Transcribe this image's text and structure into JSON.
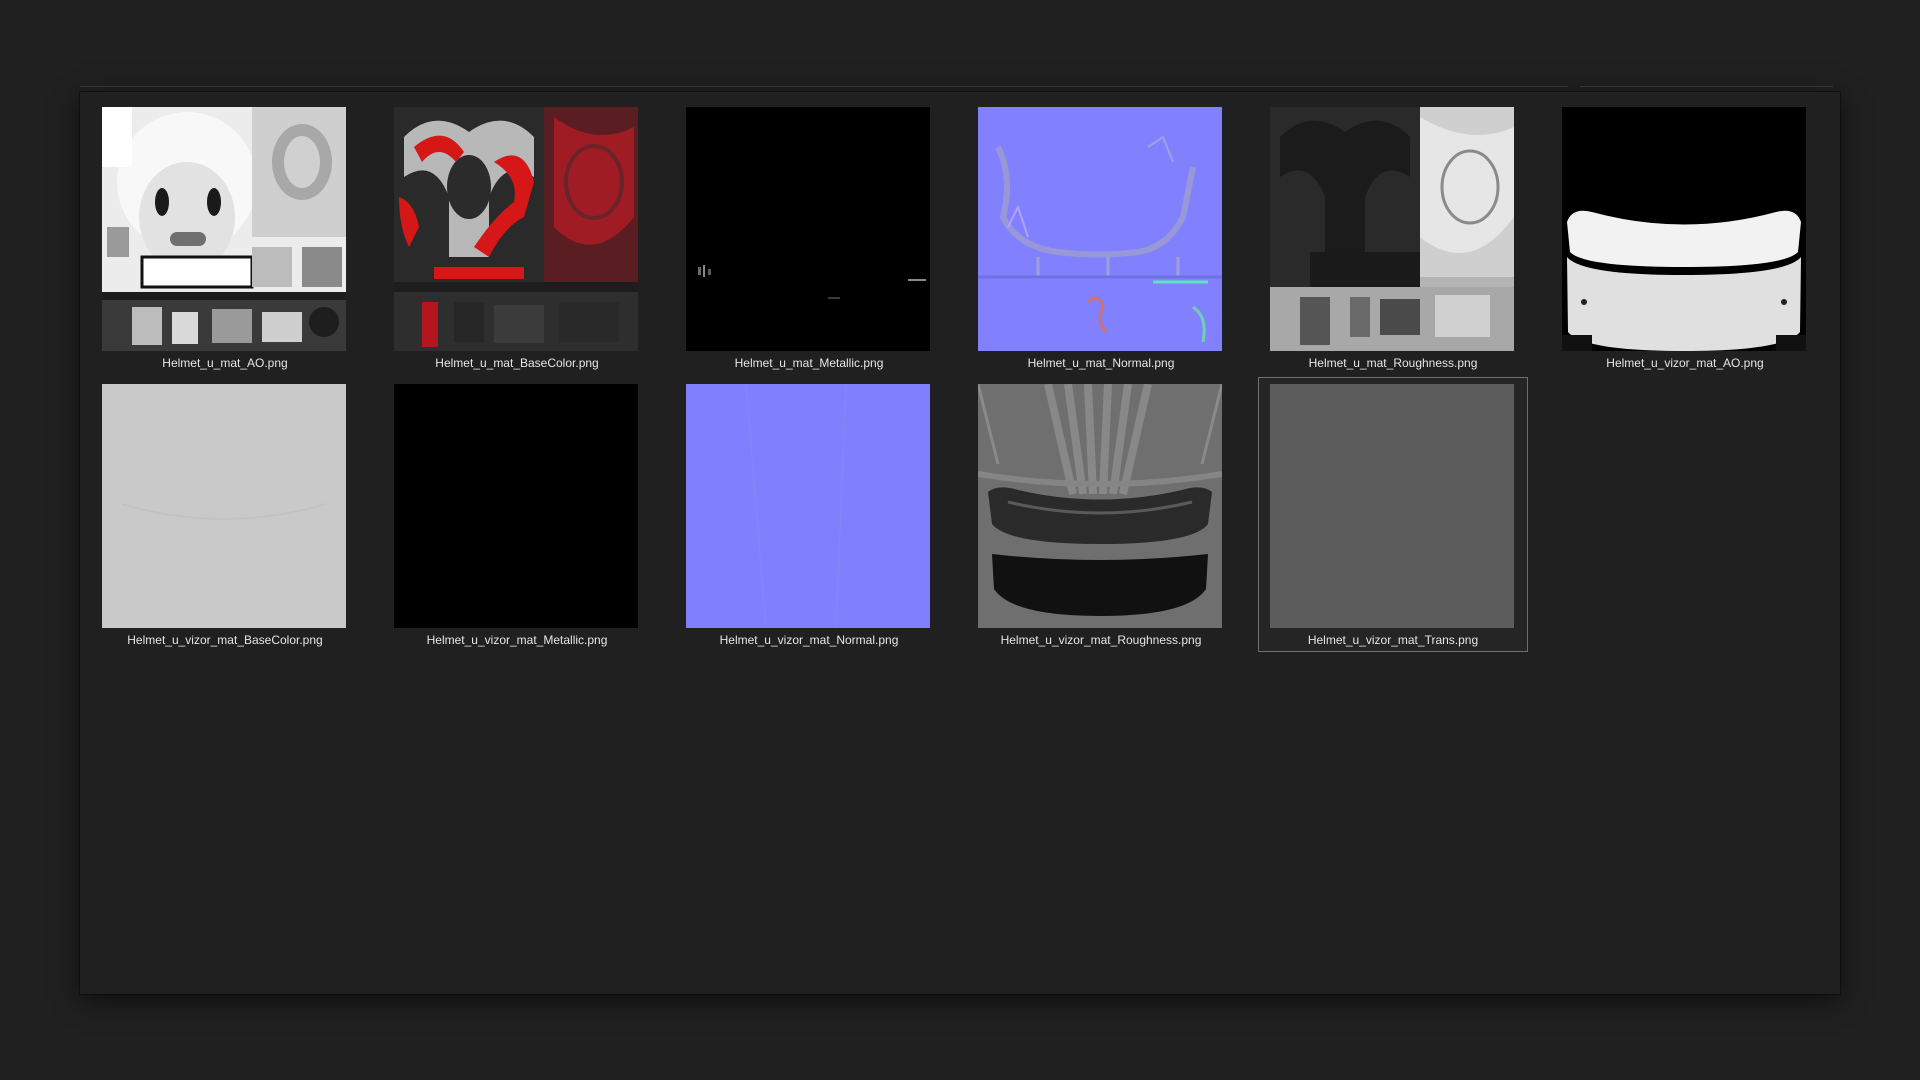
{
  "files": [
    {
      "name": "Helmet_u_mat_AO.png",
      "thumbnail": "ao-map"
    },
    {
      "name": "Helmet_u_mat_BaseColor.png",
      "thumbnail": "basecolor-map"
    },
    {
      "name": "Helmet_u_mat_Metallic.png",
      "thumbnail": "metallic-map"
    },
    {
      "name": "Helmet_u_mat_Normal.png",
      "thumbnail": "normal-map"
    },
    {
      "name": "Helmet_u_mat_Roughness.png",
      "thumbnail": "roughness-map"
    },
    {
      "name": "Helmet_u_vizor_mat_AO.png",
      "thumbnail": "vizor-ao-map"
    },
    {
      "name": "Helmet_u_vizor_mat_BaseColor.png",
      "thumbnail": "vizor-basecolor-map"
    },
    {
      "name": "Helmet_u_vizor_mat_Metallic.png",
      "thumbnail": "vizor-metallic-map"
    },
    {
      "name": "Helmet_u_vizor_mat_Normal.png",
      "thumbnail": "vizor-normal-map"
    },
    {
      "name": "Helmet_u_vizor_mat_Roughness.png",
      "thumbnail": "vizor-roughness-map"
    },
    {
      "name": "Helmet_u_vizor_mat_Trans.png",
      "thumbnail": "vizor-trans-map",
      "selected": true
    }
  ],
  "colors": {
    "background": "#202020",
    "normal_blue": "#7f7fff",
    "red_accent": "#c8102e",
    "selection_border": "#6e6e6e"
  }
}
